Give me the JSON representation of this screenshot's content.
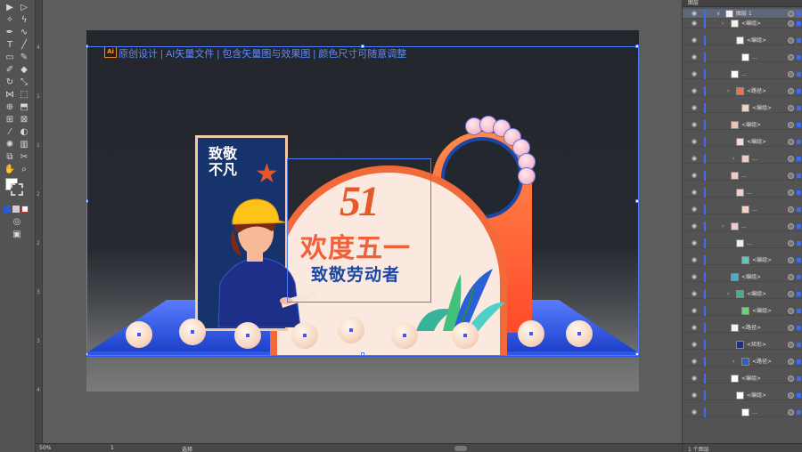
{
  "artboard": {
    "ai_badge": "Ai",
    "header_text": "原创设计 | AI矢量文件 | 包含矢量图与效果图 | 颜色尺寸可随意调整"
  },
  "design": {
    "panel_title": "致敬\n不凡",
    "title_51": "51",
    "title_main": "欢度五一",
    "title_sub": "致敬劳动者"
  },
  "layers_panel": {
    "header": "图层",
    "top_layer_name": "图层 1",
    "rows": [
      "<编组>",
      "<编组>",
      "...",
      "...",
      "<路径>",
      "<编组>",
      "<编组>",
      "<编组>",
      "...",
      "...",
      "...",
      "...",
      "...",
      "...",
      "<编组>",
      "<编组>",
      "<编组>",
      "<编组>",
      "<路径>",
      "<矩形>",
      "<路径>",
      "<编组>",
      "<编组>",
      "..."
    ],
    "footer": "1 个图层"
  },
  "statusbar": {
    "zoom": "50%",
    "page": "1",
    "mode": "选择"
  },
  "colors": {
    "selection": "#4a7cff",
    "accent_orange": "#f2603a",
    "deep_blue": "#1b47a8"
  }
}
